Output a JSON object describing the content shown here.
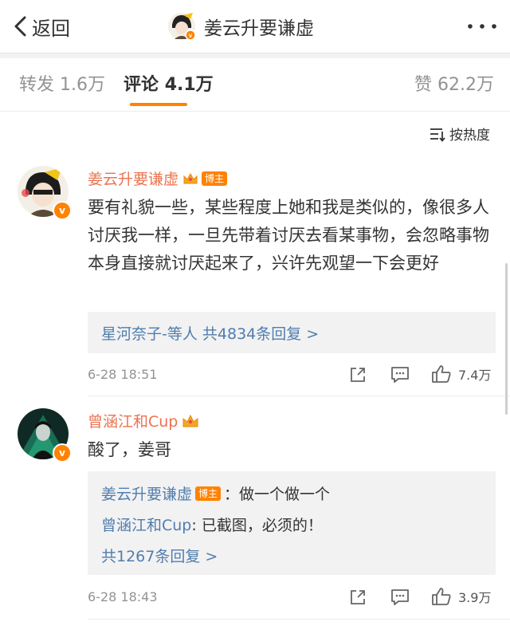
{
  "nav": {
    "back_label": "返回",
    "title": "姜云升要谦虚"
  },
  "tabs": [
    {
      "label": "转发",
      "count": "1.6万"
    },
    {
      "label": "评论",
      "count": "4.1万"
    },
    {
      "label": "赞",
      "count": "62.2万"
    }
  ],
  "sort": {
    "label": "按热度"
  },
  "comments": [
    {
      "username": "姜云升要谦虚",
      "badge": "博主",
      "text": "要有礼貌一些，某些程度上她和我是类似的，像很多人讨厌我一样，一旦先带着讨厌去看某事物，会忽略事物本身直接就讨厌起来了，兴许先观望一下会更好",
      "reply_summary": "星河奈子-等人 共4834条回复 >",
      "time": "6-28 18:51",
      "likes": "7.4万"
    },
    {
      "username": "曾涵江和Cup",
      "text": "酸了，姜哥",
      "replies": [
        {
          "user": "姜云升要谦虚",
          "badge": "博主",
          "text": "：做一个做一个"
        },
        {
          "user": "曾涵江和Cup",
          "text": ": 已截图，必须的！"
        }
      ],
      "reply_summary": "共1267条回复 >",
      "time": "6-28 18:43",
      "likes": "3.9万"
    }
  ],
  "colors": {
    "accent": "#ff8200",
    "username": "#eb7350",
    "link": "#507daf"
  }
}
